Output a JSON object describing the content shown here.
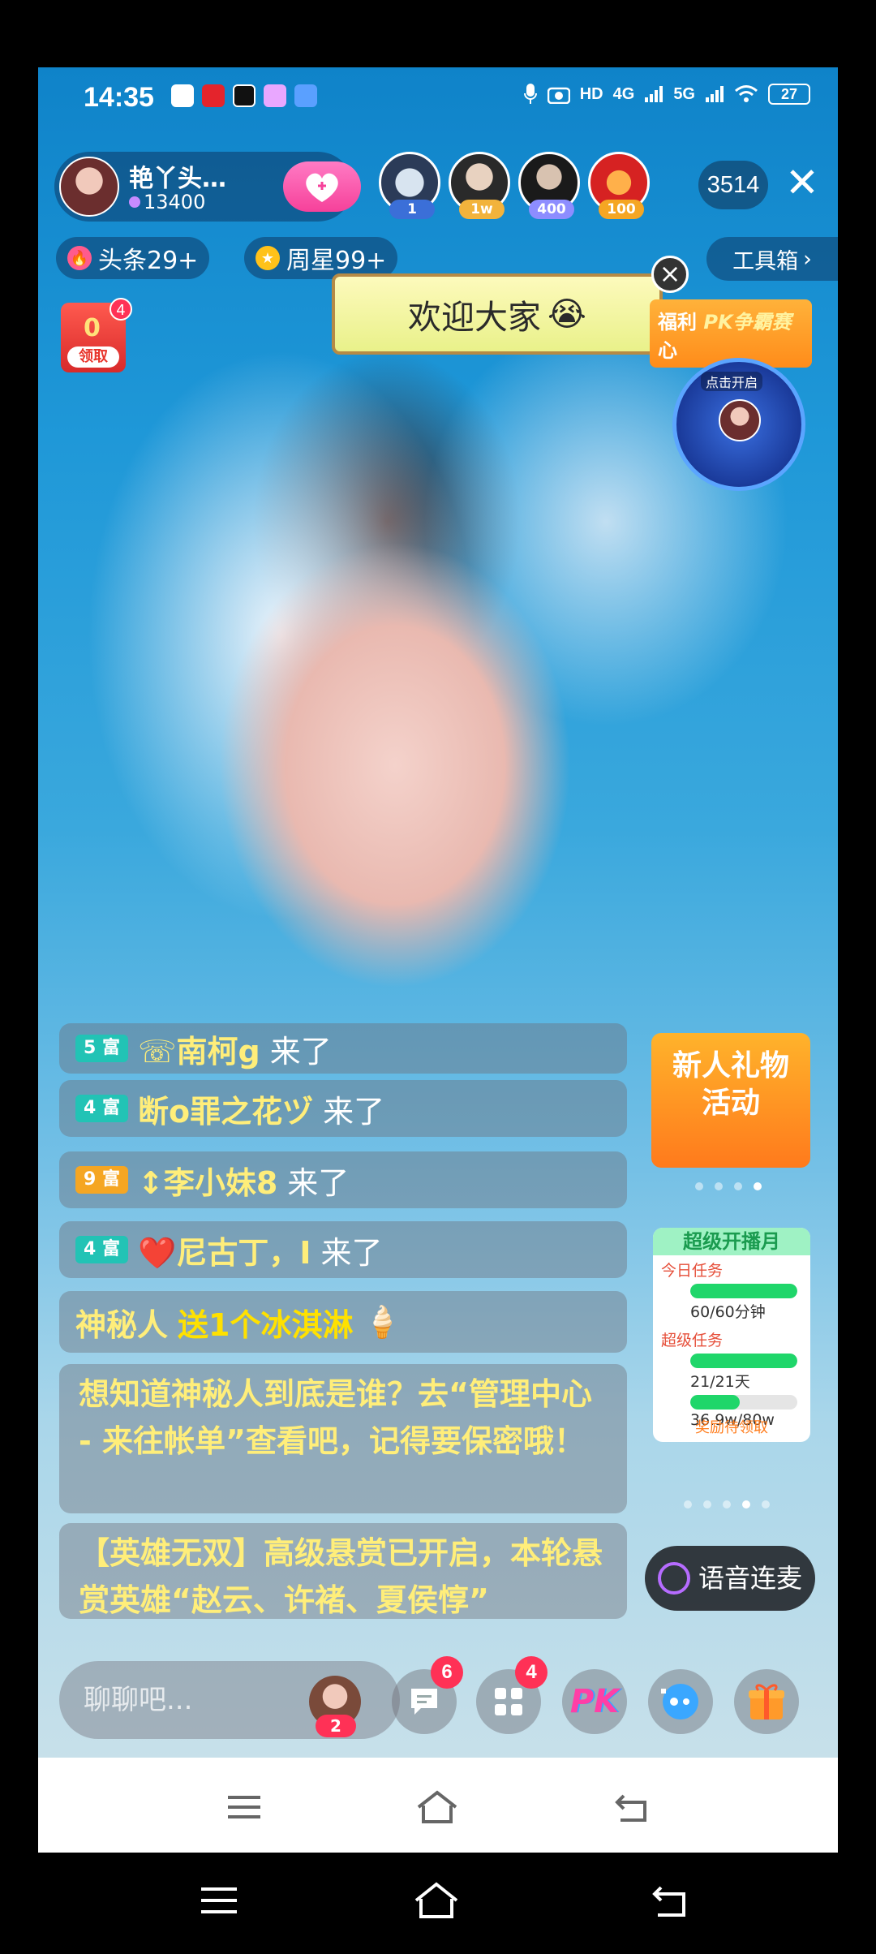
{
  "status": {
    "time": "14:35",
    "signal_labels": [
      "HD",
      "4G",
      "5G"
    ],
    "battery": "27"
  },
  "host": {
    "name": "艳丫头…",
    "stat": "13400"
  },
  "viewers": [
    {
      "badge": "1",
      "badge_color": "#3b6fd8"
    },
    {
      "badge": "1w",
      "badge_color": "#f2b33c"
    },
    {
      "badge": "400",
      "badge_color": "#8d8dff"
    },
    {
      "badge": "100",
      "badge_color": "#f5a623"
    }
  ],
  "viewer_count": "3514",
  "pills": {
    "headline": "头条29+",
    "weekly_star": "周星99+",
    "toolbox": "工具箱"
  },
  "welcome": {
    "text": "欢迎大家",
    "emoji": "😭"
  },
  "redbag": {
    "label": "领取",
    "count": "4",
    "value": "0"
  },
  "pk_banner": {
    "left": "福利",
    "title": "PK争霸赛",
    "sub": "点击开启",
    "line2": "心"
  },
  "chat_messages": [
    {
      "level": "5",
      "level_tag": "富",
      "user": "☏南柯g",
      "action": "来了",
      "color": "teal"
    },
    {
      "level": "4",
      "level_tag": "富",
      "user": "断o罪之花ヅ",
      "action": "来了",
      "color": "teal"
    },
    {
      "level": "9",
      "level_tag": "富",
      "user": "↕李小妹8",
      "action": "来了",
      "color": "gold"
    },
    {
      "level": "4",
      "level_tag": "富",
      "user": "❤️尼古丁，I",
      "action": "来了",
      "color": "teal"
    }
  ],
  "gift_msg": {
    "user": "神秘人",
    "text": "送1个冰淇淋",
    "emoji": "🍦"
  },
  "system_msgs": [
    "想知道神秘人到底是谁？去“管理中心 - 来往帐单”查看吧，记得要保密哦！",
    "【英雄无双】高级悬赏已开启，本轮悬赏英雄“赵云、许褚、夏侯惇”"
  ],
  "promo": {
    "line1": "新人礼物",
    "line2": "活动"
  },
  "task_card": {
    "title": "超级开播月",
    "today_label": "今日任务",
    "today_progress": "60/60分钟",
    "today_fraction": 1.0,
    "super_label": "超级任务",
    "super_progress": "21/21天",
    "super_fraction": 1.0,
    "extra_progress": "36.9w/80w",
    "extra_fraction": 0.46,
    "footer": "奖励待领取"
  },
  "voice": {
    "label": "语音连麦"
  },
  "bottom": {
    "input_placeholder": "聊聊吧...",
    "avatar_count": "2",
    "chat_badge": "6",
    "apps_badge": "4",
    "pk_label": "PK"
  },
  "colors": {
    "accent_pink": "#f6419a",
    "chat_yellow": "#ffee7a",
    "level_teal": "#22c3b5",
    "level_gold": "#f5a623",
    "badge_red": "#ff3156"
  }
}
